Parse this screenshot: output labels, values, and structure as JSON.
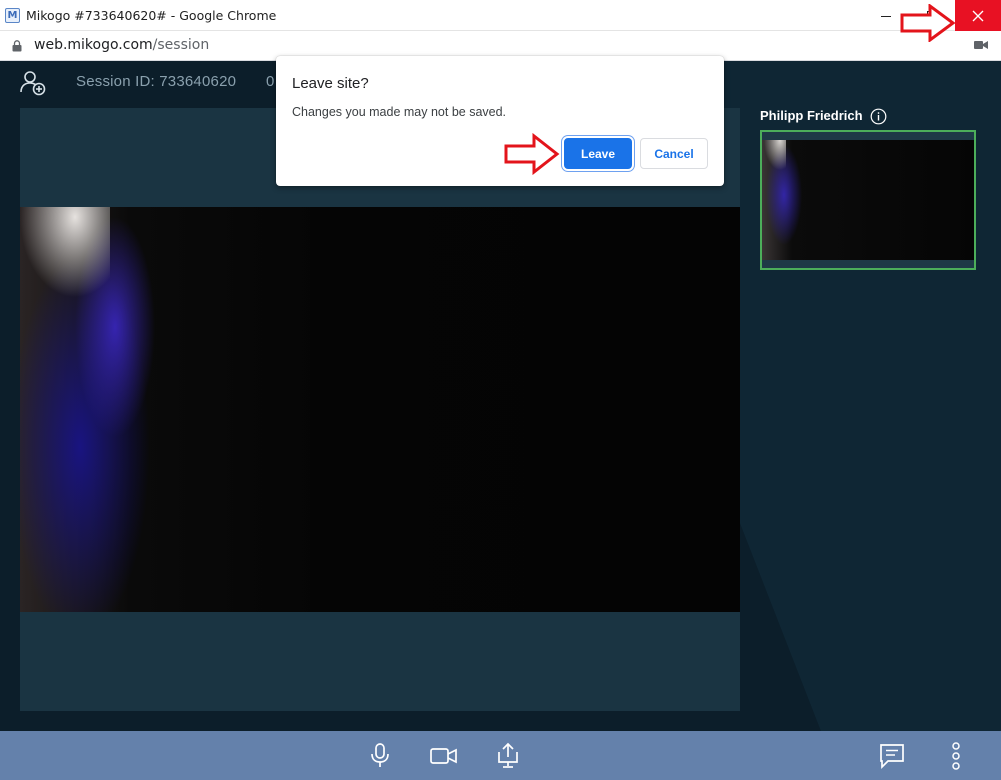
{
  "window": {
    "title": "Mikogo #733640620# - Google Chrome",
    "favicon": "M",
    "controls": {
      "minimize_icon": "minimize-icon",
      "maximize_icon": "maximize-icon",
      "close_icon": "close-icon",
      "close_bg": "#e81123"
    }
  },
  "addressbar": {
    "host": "web.mikogo.com",
    "path": "/session",
    "camera_indicator": "camera-in-use-icon"
  },
  "session": {
    "session_label": "Session ID: 733640620",
    "extra_text": "0"
  },
  "participant": {
    "name": "Philipp Friedrich",
    "border_color": "#4cae5a"
  },
  "dialog": {
    "title": "Leave site?",
    "message": "Changes you made may not be saved.",
    "leave_label": "Leave",
    "cancel_label": "Cancel",
    "accent": "#1a73e8"
  },
  "toolbar": {
    "background": "#6481ab",
    "icons": [
      "microphone-icon",
      "video-camera-icon",
      "screen-share-icon",
      "chat-icon",
      "more-vertical-icon"
    ]
  },
  "annotations": {
    "arrow_color": "#e3141b"
  }
}
